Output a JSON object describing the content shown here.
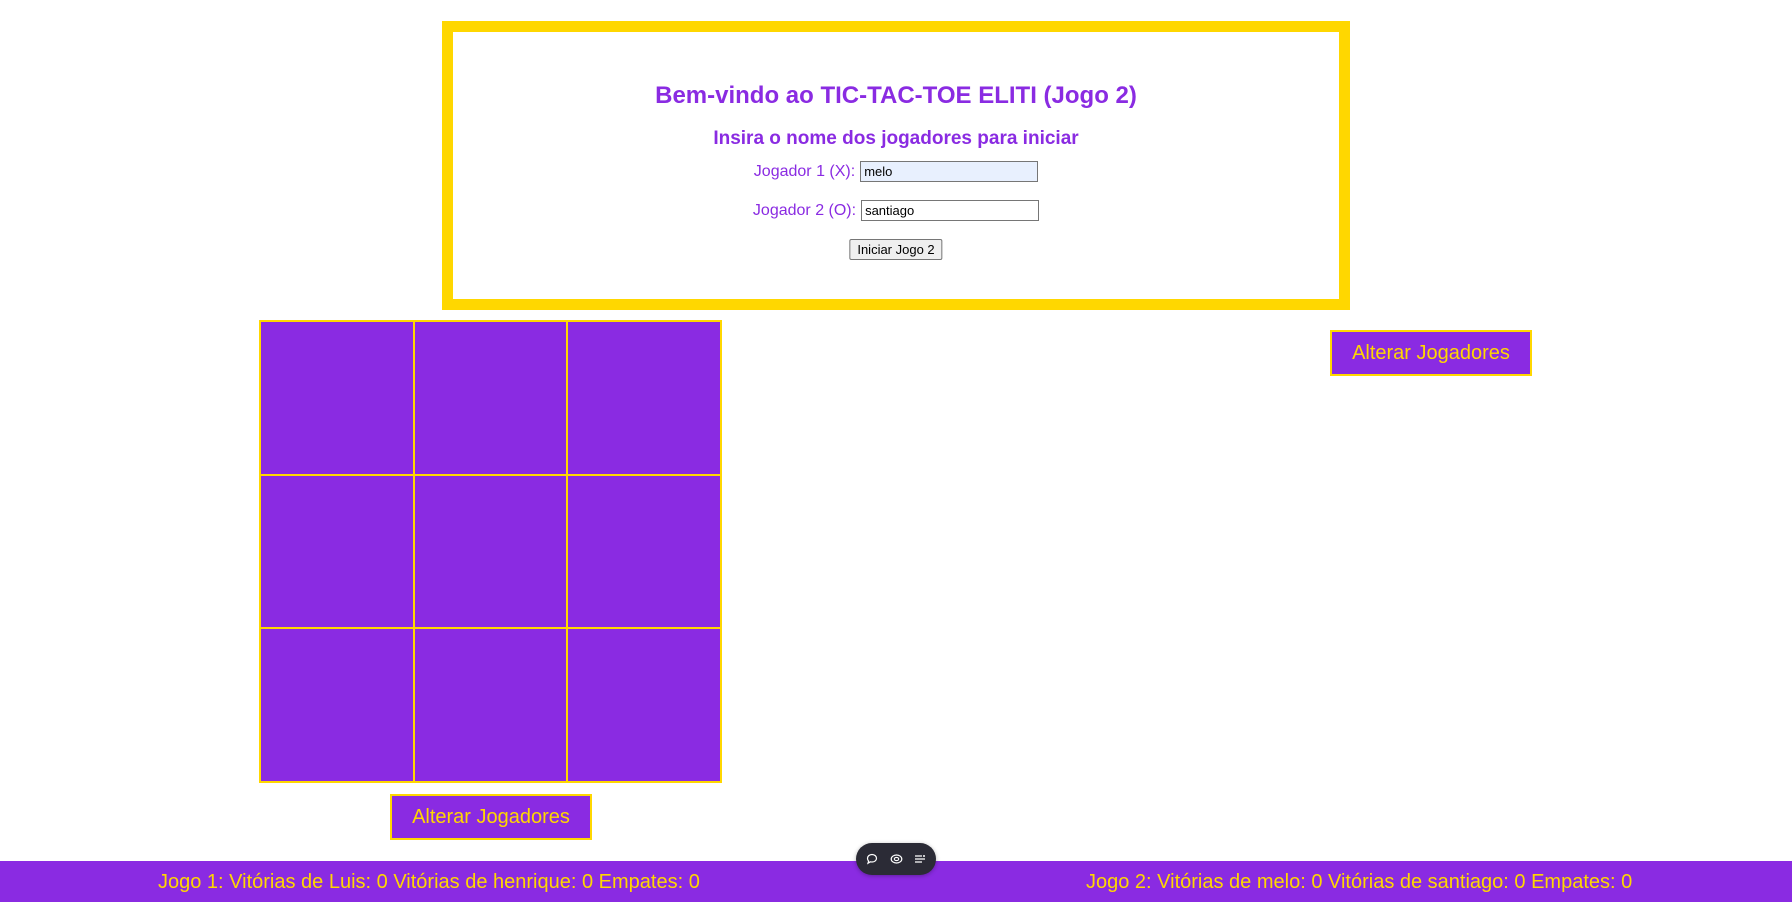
{
  "setup": {
    "title": "Bem-vindo ao TIC-TAC-TOE ELITI (Jogo 2)",
    "subtitle": "Insira o nome dos jogadores para iniciar",
    "player1_label": "Jogador 1 (X):",
    "player1_value": "melo",
    "player2_label": "Jogador 2 (O):",
    "player2_value": "santiago",
    "start_label": "Iniciar Jogo 2"
  },
  "board": {
    "cells": [
      "",
      "",
      "",
      "",
      "",
      "",
      "",
      "",
      ""
    ]
  },
  "buttons": {
    "change_players_right": "Alterar Jogadores",
    "change_players_left": "Alterar Jogadores"
  },
  "footer": {
    "game1_stats": "Jogo 1: Vitórias de Luis: 0 Vitórias de henrique: 0 Empates: 0",
    "game2_stats": "Jogo 2: Vitórias de melo: 0 Vitórias de santiago: 0 Empates: 0"
  },
  "toolbar": {
    "icons": [
      "chat-bubble-icon",
      "link-icon",
      "menu-list-icon"
    ]
  },
  "colors": {
    "primary": "#8a2be2",
    "accent": "#ffd700",
    "background": "#ffffff"
  }
}
